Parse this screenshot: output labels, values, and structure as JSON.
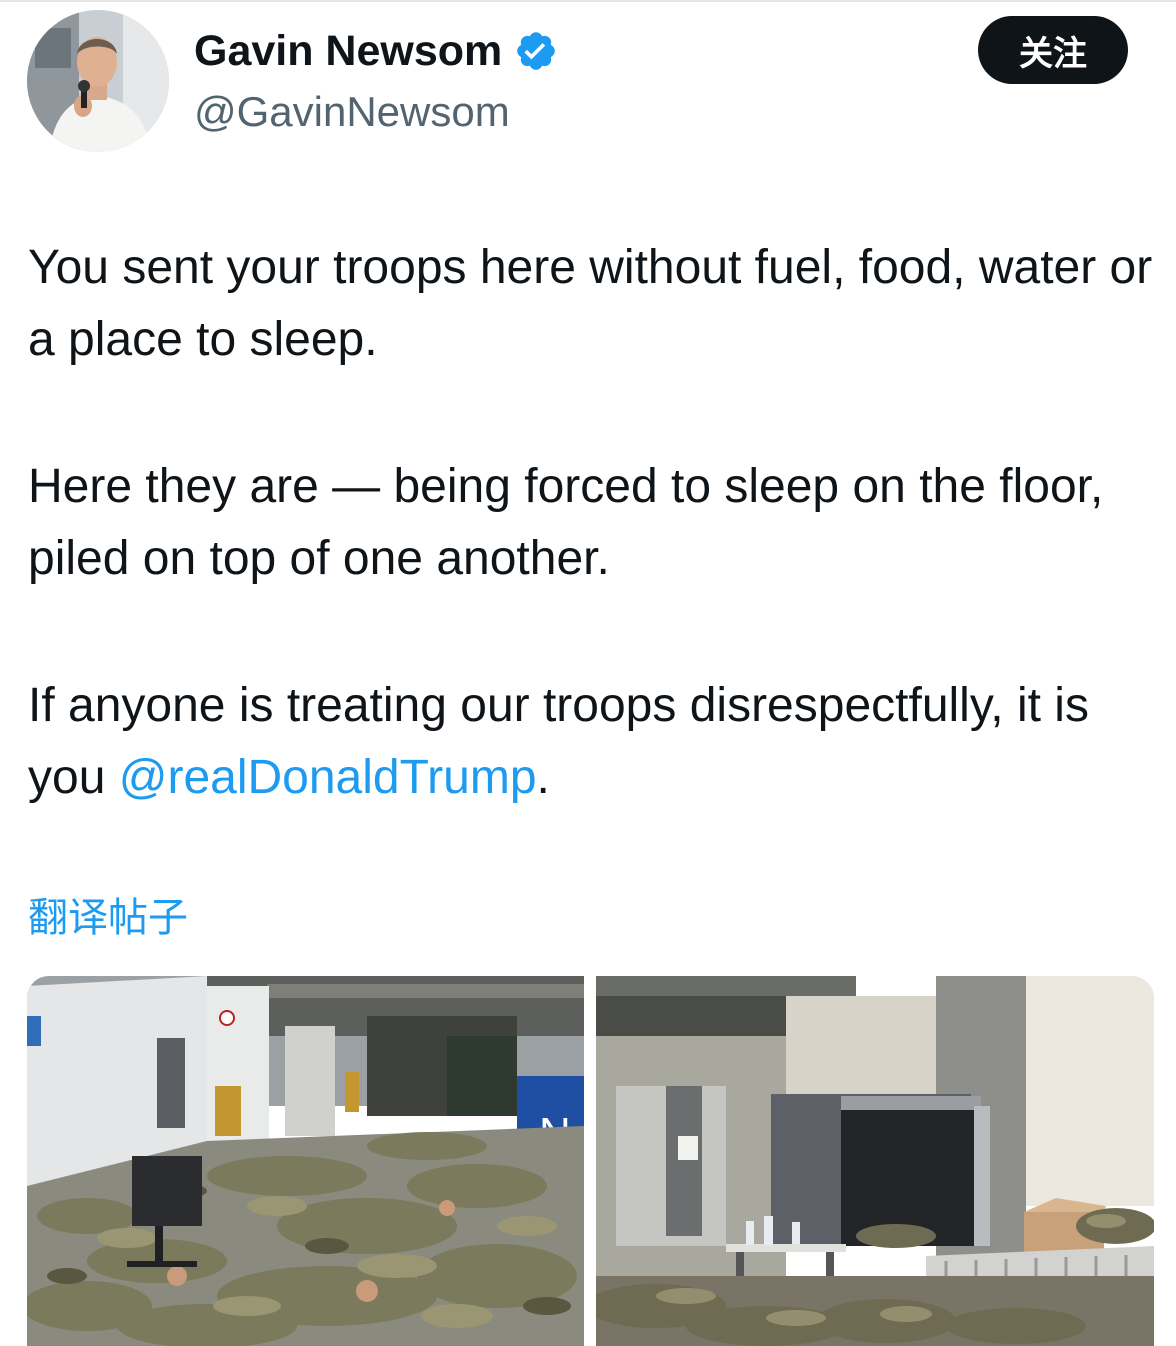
{
  "author": {
    "display_name": "Gavin Newsom",
    "handle": "@GavinNewsom",
    "verified": true
  },
  "follow_button": {
    "label": "关注"
  },
  "tweet": {
    "paragraphs": [
      "You sent your troops here without fuel, food, water or a place to sleep.",
      "Here they are — being forced to sleep on the floor, piled on top of one another."
    ],
    "last_paragraph_prefix": "If anyone is treating our troops disrespectfully, it is you ",
    "mention": "@realDonaldTrump",
    "last_paragraph_suffix": "."
  },
  "translate_label": "翻译帖子",
  "media": {
    "count": 2,
    "photo1_sign": "N"
  },
  "colors": {
    "link": "#1d9bf0",
    "text": "#0f1419",
    "secondary": "#536471",
    "follow_bg": "#0f1419"
  }
}
